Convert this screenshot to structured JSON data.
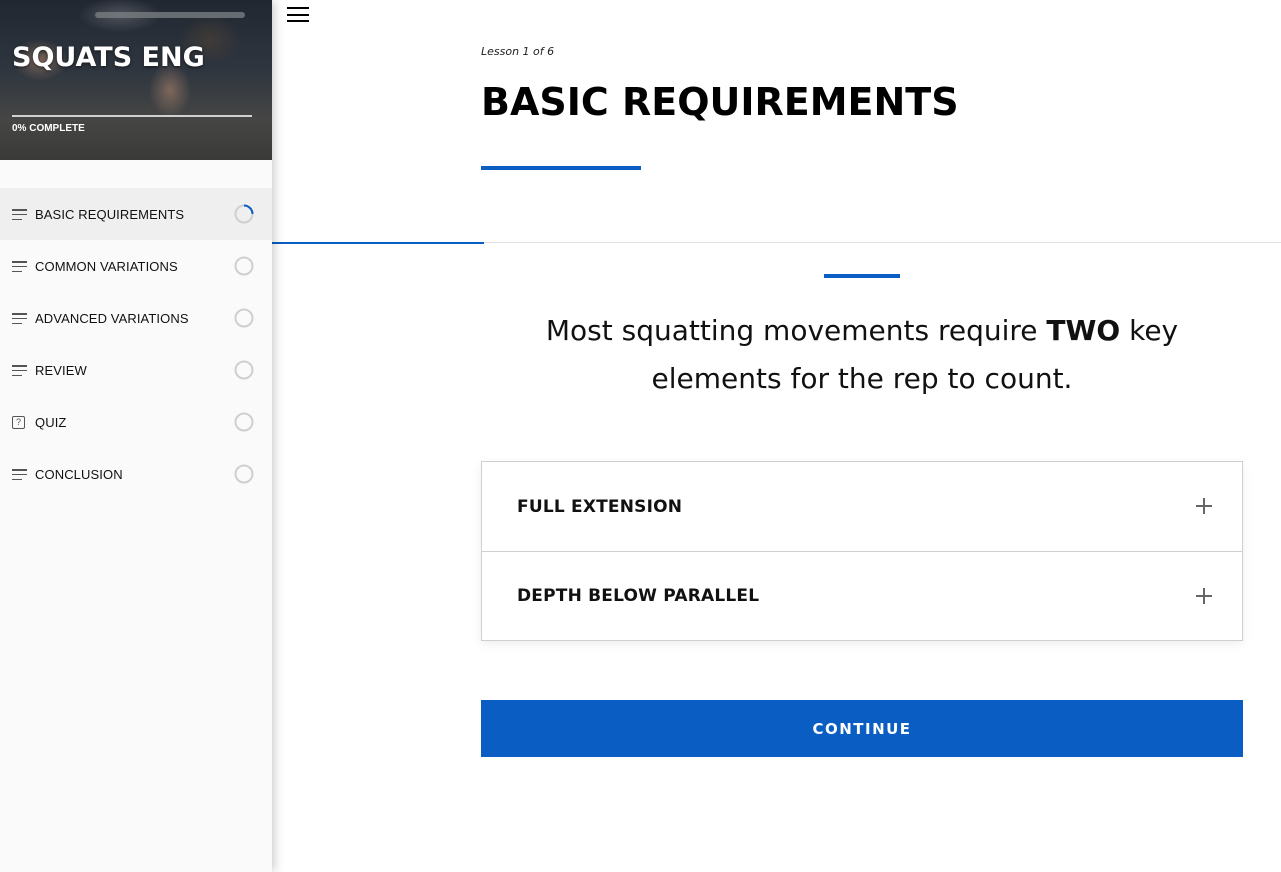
{
  "course": {
    "title": "SQUATS ENG",
    "progress_label": "0% COMPLETE",
    "progress_percent": 0
  },
  "sidebar": {
    "items": [
      {
        "label": "BASIC REQUIREMENTS",
        "icon": "lines-icon",
        "status": "in-progress",
        "active": true
      },
      {
        "label": "COMMON VARIATIONS",
        "icon": "lines-icon",
        "status": "not-started",
        "active": false
      },
      {
        "label": "ADVANCED VARIATIONS",
        "icon": "lines-icon",
        "status": "not-started",
        "active": false
      },
      {
        "label": "REVIEW",
        "icon": "lines-icon",
        "status": "not-started",
        "active": false
      },
      {
        "label": "QUIZ",
        "icon": "quiz-icon",
        "status": "not-started",
        "active": false
      },
      {
        "label": "CONCLUSION",
        "icon": "lines-icon",
        "status": "not-started",
        "active": false
      }
    ]
  },
  "lesson": {
    "count": "Lesson 1 of 6",
    "title": "BASIC REQUIREMENTS",
    "statement_before": "Most squatting movements require ",
    "statement_bold": "TWO",
    "statement_after": " key elements for the rep to count.",
    "page_progress_fraction": 0.21
  },
  "accordion": {
    "items": [
      {
        "label": "FULL EXTENSION"
      },
      {
        "label": "DEPTH BELOW PARALLEL"
      }
    ]
  },
  "continue_label": "CONTINUE",
  "colors": {
    "accent": "#0a5dc2",
    "sidebar_bg": "#fafafa",
    "active_item_bg": "#efefef"
  }
}
